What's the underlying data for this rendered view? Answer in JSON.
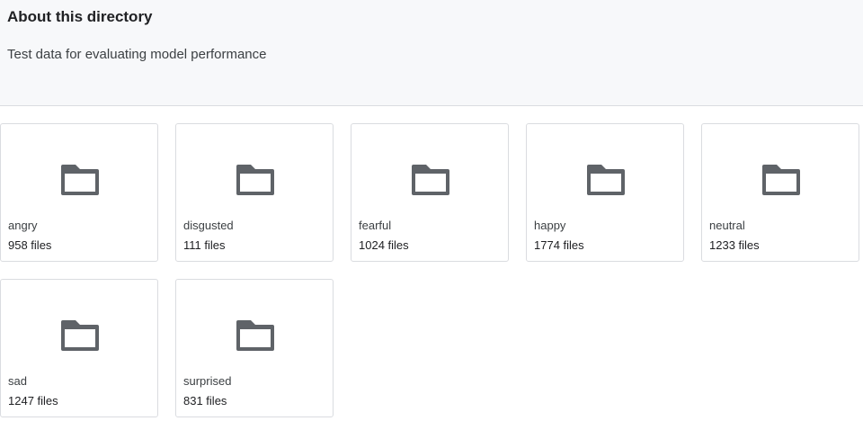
{
  "about": {
    "title": "About this directory",
    "description": "Test data for evaluating model performance"
  },
  "folders": [
    {
      "name": "angry",
      "count": "958 files",
      "icon": "folder-icon"
    },
    {
      "name": "disgusted",
      "count": "111 files",
      "icon": "folder-icon"
    },
    {
      "name": "fearful",
      "count": "1024 files",
      "icon": "folder-icon"
    },
    {
      "name": "happy",
      "count": "1774 files",
      "icon": "folder-icon"
    },
    {
      "name": "neutral",
      "count": "1233 files",
      "icon": "folder-icon"
    },
    {
      "name": "sad",
      "count": "1247 files",
      "icon": "folder-icon"
    },
    {
      "name": "surprised",
      "count": "831 files",
      "icon": "folder-icon"
    }
  ],
  "colors": {
    "folder_icon": "#5f6368",
    "header_bg": "#f7f8fa",
    "border": "#dadce0"
  }
}
